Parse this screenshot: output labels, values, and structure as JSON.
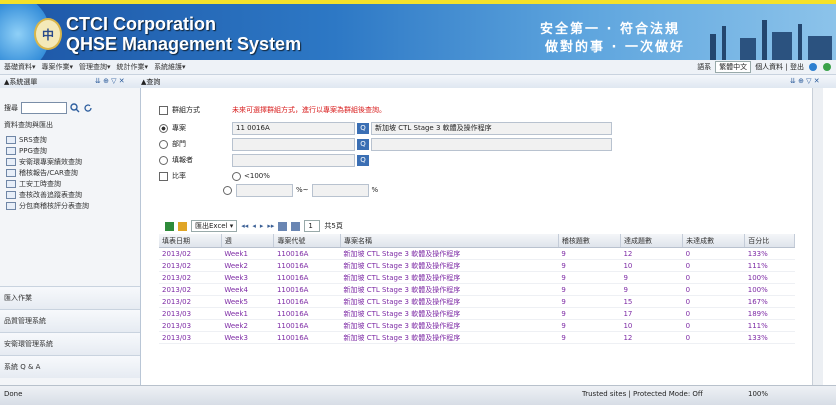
{
  "banner": {
    "title_line1": "CTCI Corporation",
    "title_line2": "QHSE Management System",
    "slogan_line1": "安全第一 · 符合法規",
    "slogan_line2": "做對的事 · 一次做好"
  },
  "menubar": {
    "items": [
      "基礎資料▾",
      "專案作業▾",
      "管理查詢▾",
      "統計作業▾",
      "系統維護▾"
    ],
    "right_label": "語系",
    "lang_select": "繁體中文",
    "right_links": "個人資料 | 登出"
  },
  "toolbar_left": "▲系統選單",
  "toolbar_right": "▲查詢",
  "sidebar": {
    "search_label": "搜尋",
    "section_title": "資料查詢與匯出",
    "items": [
      "SRS查詢",
      "PPG查詢",
      "安衛環專案績效查詢",
      "稽核報告/CAR查詢",
      "工安工時查詢",
      "查核改善追蹤表查詢",
      "分包商稽核評分表查詢"
    ],
    "bottom": [
      "匯入作業",
      "品質管理系統",
      "安衛環管理系統",
      "系統 Q & A"
    ]
  },
  "main": {
    "header": "▲查詢條件",
    "form": {
      "mode_label": "群組方式",
      "mode_hint": "未來可選擇群組方式，進行以專案為群組後查詢。",
      "project_label": "專案",
      "project_code": "11 0016A",
      "project_name": "新加坡 CTL Stage 3 軟體及操作程序",
      "dept_label": "部門",
      "person_label": "填報者",
      "ratio_label": "比率",
      "ratio_hint": "<100%",
      "pct1": "%~",
      "pct2": "%"
    },
    "toolbar": {
      "select_label": "匯出Excel ▾",
      "page_value": "1",
      "page_suffix": "共5頁"
    },
    "table": {
      "headers": [
        "填表日期",
        "週",
        "專案代號",
        "專案名稱",
        "稽核題數",
        "達成題數",
        "未達成數",
        "百分比"
      ],
      "rows": [
        [
          "2013/02",
          "Week1",
          "110016A",
          "新加坡 CTL Stage 3 軟體及操作程序",
          "9",
          "12",
          "0",
          "133%"
        ],
        [
          "2013/02",
          "Week2",
          "110016A",
          "新加坡 CTL Stage 3 軟體及操作程序",
          "9",
          "10",
          "0",
          "111%"
        ],
        [
          "2013/02",
          "Week3",
          "110016A",
          "新加坡 CTL Stage 3 軟體及操作程序",
          "9",
          "9",
          "0",
          "100%"
        ],
        [
          "2013/02",
          "Week4",
          "110016A",
          "新加坡 CTL Stage 3 軟體及操作程序",
          "9",
          "9",
          "0",
          "100%"
        ],
        [
          "2013/02",
          "Week5",
          "110016A",
          "新加坡 CTL Stage 3 軟體及操作程序",
          "9",
          "15",
          "0",
          "167%"
        ],
        [
          "2013/03",
          "Week1",
          "110016A",
          "新加坡 CTL Stage 3 軟體及操作程序",
          "9",
          "17",
          "0",
          "189%"
        ],
        [
          "2013/03",
          "Week2",
          "110016A",
          "新加坡 CTL Stage 3 軟體及操作程序",
          "9",
          "10",
          "0",
          "111%"
        ],
        [
          "2013/03",
          "Week3",
          "110016A",
          "新加坡 CTL Stage 3 軟體及操作程序",
          "9",
          "12",
          "0",
          "133%"
        ]
      ]
    }
  },
  "status": {
    "left": "Done",
    "middle": "Trusted sites | Protected Mode: Off",
    "right": "100%"
  }
}
